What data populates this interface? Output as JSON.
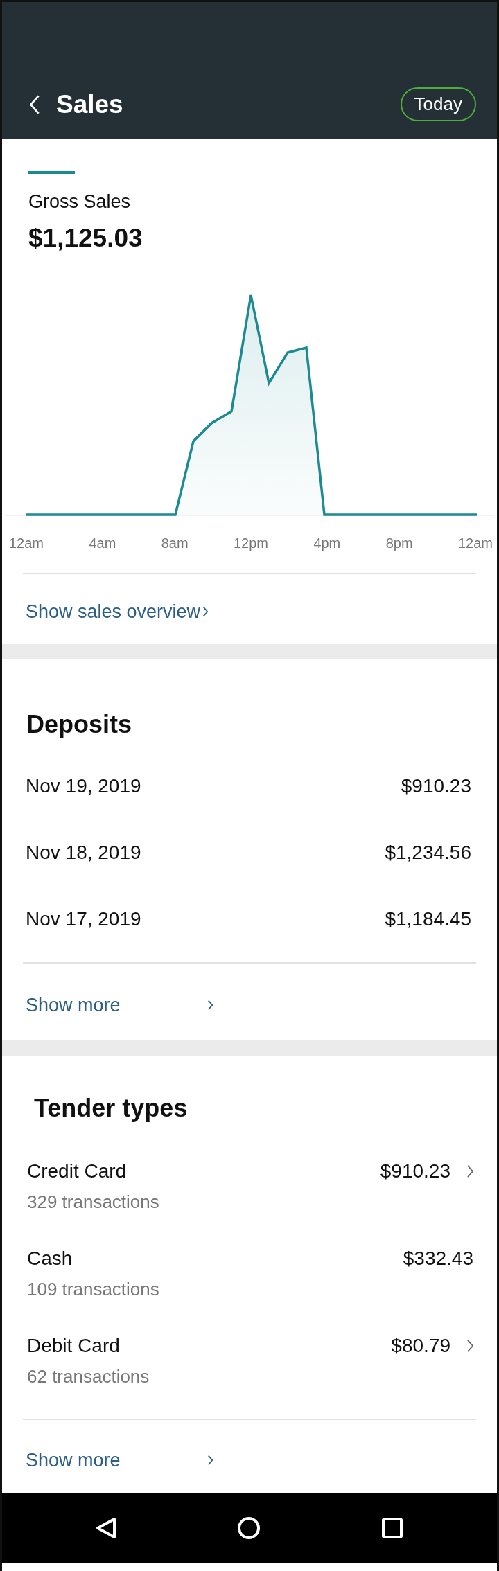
{
  "header": {
    "title": "Sales",
    "period": "Today"
  },
  "gross_sales": {
    "label": "Gross Sales",
    "amount": "$1,125.03",
    "x_labels": [
      "12am",
      "4am",
      "8am",
      "12pm",
      "4pm",
      "8pm",
      "12am"
    ],
    "link": "Show sales overview"
  },
  "deposits": {
    "title": "Deposits",
    "rows": [
      {
        "date": "Nov 19, 2019",
        "amount": "$910.23"
      },
      {
        "date": "Nov 18, 2019",
        "amount": "$1,234.56"
      },
      {
        "date": "Nov 17, 2019",
        "amount": "$1,184.45"
      }
    ],
    "link": "Show more"
  },
  "tender_types": {
    "title": "Tender types",
    "rows": [
      {
        "name": "Credit Card",
        "count": "329 transactions",
        "amount": "$910.23",
        "chevron": true
      },
      {
        "name": "Cash",
        "count": "109 transactions",
        "amount": "$332.43",
        "chevron": false
      },
      {
        "name": "Debit Card",
        "count": "62 transactions",
        "amount": "$80.79",
        "chevron": true
      }
    ],
    "link": "Show more"
  }
}
